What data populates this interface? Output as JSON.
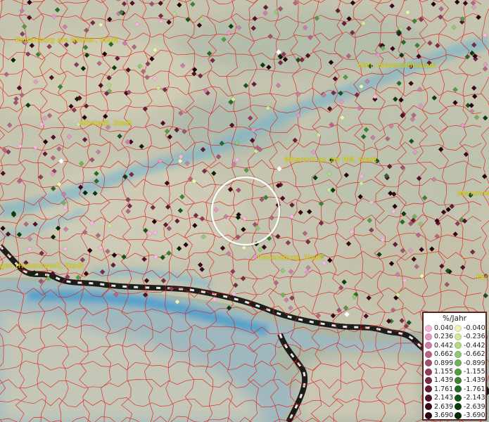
{
  "map": {
    "labels": [
      {
        "text": "Rottenburg am Neckar, Stadt"
      },
      {
        "text": "Ulm, Universitätsstadt"
      },
      {
        "text": "Albstadt, Stadt"
      },
      {
        "text": "Biberach an der Riß, Stadt"
      },
      {
        "text": "Memming"
      },
      {
        "text": "Ravensburg, Stadt"
      },
      {
        "text": "gen (Hohentwiel), Stadt"
      },
      {
        "text": "Ker"
      }
    ]
  },
  "legend": {
    "title": "%/Jahr",
    "positive": [
      {
        "value": "0.040",
        "color": "#f6b8e0"
      },
      {
        "value": "0.236",
        "color": "#e59ac6"
      },
      {
        "value": "0.442",
        "color": "#cc7fa6"
      },
      {
        "value": "0.662",
        "color": "#b76585"
      },
      {
        "value": "0.899",
        "color": "#a2506f"
      },
      {
        "value": "1.155",
        "color": "#8e3c5a"
      },
      {
        "value": "1.439",
        "color": "#7a2a47"
      },
      {
        "value": "1.761",
        "color": "#661b36"
      },
      {
        "value": "2.143",
        "color": "#520f27"
      },
      {
        "value": "2.639",
        "color": "#3e0719"
      },
      {
        "value": "3.690",
        "color": "#27020c"
      }
    ],
    "negative": [
      {
        "value": "-0.040",
        "color": "#eaf5b0"
      },
      {
        "value": "-0.236",
        "color": "#cfe89e"
      },
      {
        "value": "-0.442",
        "color": "#b2da8a"
      },
      {
        "value": "-0.662",
        "color": "#92c774"
      },
      {
        "value": "-0.899",
        "color": "#72b25c"
      },
      {
        "value": "-1.155",
        "color": "#549b45"
      },
      {
        "value": "-1.439",
        "color": "#3c8333"
      },
      {
        "value": "-1.761",
        "color": "#286b24"
      },
      {
        "value": "-2.143",
        "color": "#185418"
      },
      {
        "value": "-2.639",
        "color": "#0c3d0d"
      },
      {
        "value": "-3.690",
        "color": "#062706"
      }
    ]
  },
  "colors": {
    "boundary": "#e0201c",
    "label": "#e8e000",
    "water": "#5fb0d8",
    "selection_ring": "#ffffff"
  }
}
